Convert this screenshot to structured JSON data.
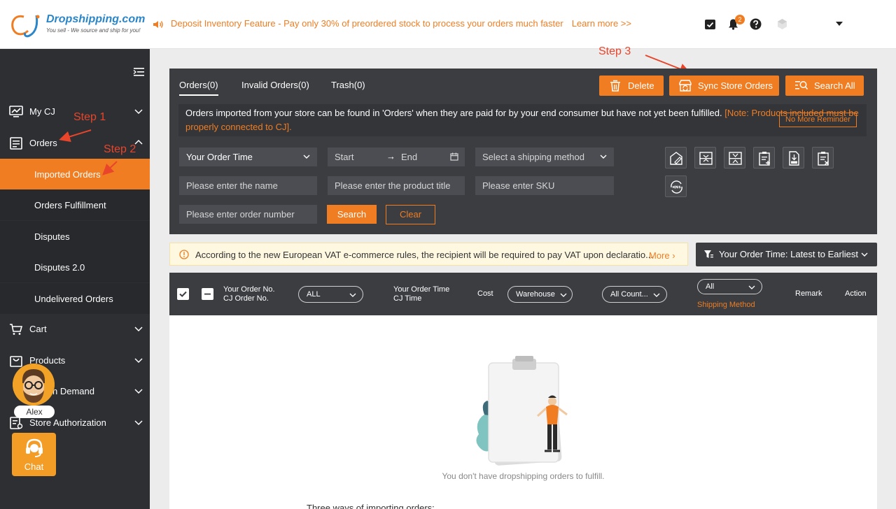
{
  "header": {
    "logo_name": "Dropshipping.com",
    "logo_tagline": "You sell - We source and ship for you!",
    "announcement": "Deposit Inventory Feature - Pay only 30% of preordered stock to process your orders much faster",
    "learn_more": "Learn more >>",
    "notification_count": "2"
  },
  "sidebar": {
    "my_cj": "My CJ",
    "orders": "Orders",
    "submenu": [
      "Imported Orders",
      "Orders Fulfillment",
      "Disputes",
      "Disputes 2.0",
      "Undelivered Orders"
    ],
    "cart": "Cart",
    "products": "Products",
    "print_on_demand": "n Demand",
    "store_authorization": "Store Authorization",
    "agent_name": "Alex",
    "chat": "Chat"
  },
  "annotations": {
    "step1": "Step 1",
    "step2": "Step 2",
    "step3": "Step 3"
  },
  "tabs": [
    "Orders(0)",
    "Invalid Orders(0)",
    "Trash(0)"
  ],
  "actions": {
    "delete": "Delete",
    "sync": "Sync Store Orders",
    "search_all": "Search All"
  },
  "notice": {
    "text": "Orders imported from your store can be found in 'Orders' when they are paid for by your end consumer but have not yet been fulfilled.",
    "note": "[Note: Products included must be properly connected to CJ].",
    "no_more": "No More Reminder"
  },
  "filters": {
    "order_time": "Your Order Time",
    "start": "Start",
    "end": "End",
    "shipping_method": "Select a shipping method",
    "name_placeholder": "Please enter the name",
    "product_title_placeholder": "Please enter the product title",
    "sku_placeholder": "Please enter SKU",
    "order_number_placeholder": "Please enter order number",
    "search": "Search",
    "clear": "Clear"
  },
  "vat": {
    "text": "According to the new European VAT e-commerce rules, the recipient will be required to pay VAT upon declaratio...",
    "more": "More"
  },
  "sort": "Your Order Time: Latest to Earliest",
  "table_header": {
    "order_no": "Your Order No.",
    "cj_order_no": "CJ Order No.",
    "all": "ALL",
    "order_time": "Your Order Time",
    "cj_time": "CJ Time",
    "cost": "Cost",
    "warehouse": "Warehouse",
    "country": "All Count...",
    "shipping_all": "All",
    "shipping_method": "Shipping Method",
    "remark": "Remark",
    "action": "Action"
  },
  "empty": {
    "message": "You don't have dropshipping orders to fulfill.",
    "three_ways": "Three ways of importing orders:"
  },
  "colors": {
    "accent": "#f07d22",
    "sidebar": "#2d2f33",
    "panel": "#3b3d41",
    "annotation": "#e8452b"
  }
}
